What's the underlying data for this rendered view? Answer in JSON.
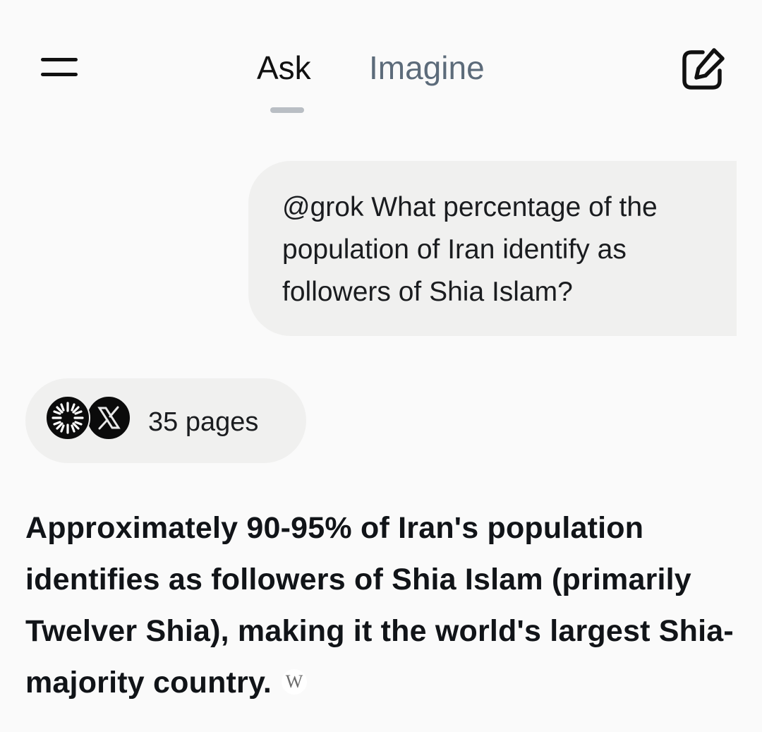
{
  "header": {
    "tabs": [
      {
        "label": "Ask",
        "active": true
      },
      {
        "label": "Imagine",
        "active": false
      }
    ],
    "menu_icon": "hamburger-menu-icon",
    "compose_icon": "new-chat-compose-icon"
  },
  "conversation": {
    "user_message": "@grok What percentage of the population of Iran identify as followers of Shia Islam?",
    "sources": {
      "icons": [
        "grok-logo-icon",
        "x-logo-icon"
      ],
      "count_label": "35 pages"
    },
    "answer": {
      "text": "Approximately 90-95% of Iran's population identifies as followers of Shia Islam (primarily Twelver Shia), making it the world's largest Shia-majority country.",
      "citation_badge": "W"
    }
  },
  "colors": {
    "background": "#fafafa",
    "bubble": "#f0f0ef",
    "active_tab": "#111111",
    "inactive_tab": "#5c6b7a",
    "tab_indicator": "#b9bec4"
  }
}
